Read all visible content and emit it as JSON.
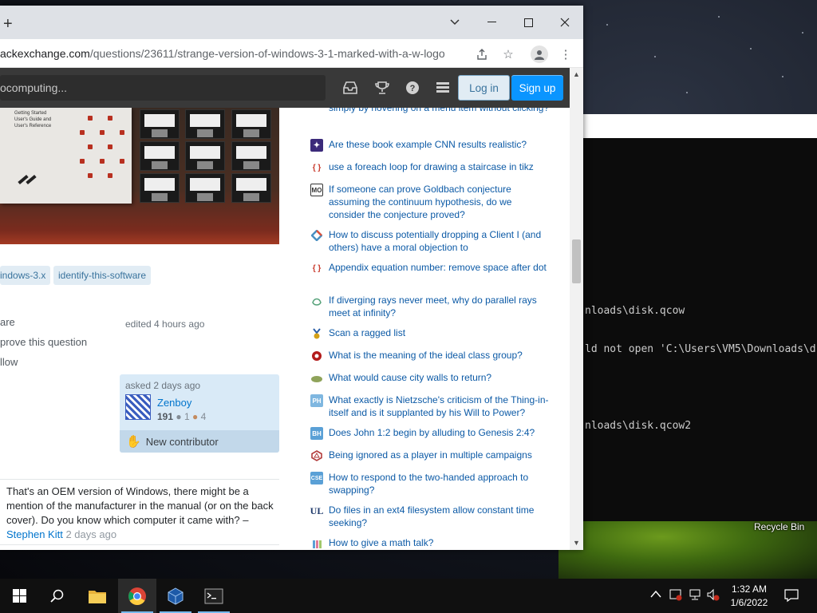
{
  "desktop": {
    "recycle_bin_label": "Recycle Bin"
  },
  "terminal": {
    "lines": [
      "nloads\\disk.qcow",
      "ld not open 'C:\\Users\\VM5\\Downloads\\d",
      "",
      "nloads\\disk.qcow2"
    ]
  },
  "browser": {
    "new_tab_icon": "plus-icon",
    "url_host": "ackexchange.com",
    "url_path": "/questions/23611/strange-version-of-windows-3-1-marked-with-a-w-logo",
    "window_controls": [
      "chevron-down-icon",
      "minimize-icon",
      "maximize-icon",
      "close-icon"
    ]
  },
  "site": {
    "search_text": "ocomputing...",
    "login_label": "Log in",
    "signup_label": "Sign up"
  },
  "question": {
    "photo_manual_title": "Getting Started\nUser's Guide and\nUser's Reference",
    "tags": [
      "indows-3.x",
      "identify-this-software"
    ],
    "actions": [
      "are",
      "prove this question",
      "llow"
    ],
    "edited_text": "edited 4 hours ago",
    "asked_text": "asked 2 days ago",
    "user_name": "Zenboy",
    "user_rep": "191",
    "silver_badges": "1",
    "bronze_badges": "4",
    "new_contributor_label": "New contributor"
  },
  "comment": {
    "text": "That's an OEM version of Windows, there might be a mention of the manufacturer in the manual (or on the back cover). Do you know which computer it came with?",
    "dash": "–",
    "author": "Stephen Kitt",
    "date": "2 days ago"
  },
  "hot_questions": [
    {
      "title": "simply by hovering on a menu item without clicking?",
      "icon": "none",
      "color": "#ffffff"
    },
    {
      "title": "Are these book example CNN results realistic?",
      "icon": "datascience-icon",
      "color": "#3b2a7a"
    },
    {
      "title": "use a foreach loop for drawing a staircase in tikz",
      "icon": "tex-icon",
      "color": "#c93b2d"
    },
    {
      "title": "If someone can prove Goldbach conjecture assuming the continuum hypothesis, do we consider the conjecture proved?",
      "icon": "mathoverflow-icon",
      "color": "#333333"
    },
    {
      "title": "How to discuss potentially dropping a Client I (and others) have a moral objection to",
      "icon": "workplace-icon",
      "color": "#4a90c2"
    },
    {
      "title": "Appendix equation number: remove space after dot",
      "icon": "tex-icon",
      "color": "#c93b2d"
    },
    {
      "title": "If diverging rays never meet, why do parallel rays meet at infinity?",
      "icon": "physics-icon",
      "color": "#56a27a"
    },
    {
      "title": "Scan a ragged list",
      "icon": "codegolf-icon",
      "color": "#d4a017"
    },
    {
      "title": "What is the meaning of the ideal class group?",
      "icon": "math-icon",
      "color": "#b21b1b"
    },
    {
      "title": "What would cause city walls to return?",
      "icon": "worldbuilding-icon",
      "color": "#8fa35a"
    },
    {
      "title": "What exactly is Nietzsche's criticism of the Thing-in-itself and is it supplanted by his Will to Power?",
      "icon": "philosophy-icon",
      "color": "#7fb7e0"
    },
    {
      "title": "Does John 1:2 begin by alluding to Genesis 2:4?",
      "icon": "hermeneutics-icon",
      "color": "#5aa0d6"
    },
    {
      "title": "Being ignored as a player in multiple campaigns",
      "icon": "rpg-icon",
      "color": "#b23b3b"
    },
    {
      "title": "How to respond to the two-handed approach to swapping?",
      "icon": "cs-icon",
      "color": "#5aa0d6"
    },
    {
      "title": "Do files in an ext4 filesystem allow constant time seeking?",
      "icon": "unix-icon",
      "color": "#1f3a6b"
    },
    {
      "title": "How to give a math talk?",
      "icon": "academia-icon",
      "color": "#5aa0d6"
    }
  ],
  "taskbar": {
    "time": "1:32 AM",
    "date": "1/6/2022",
    "items": [
      "windows-start-icon",
      "search-icon",
      "file-explorer-icon",
      "chrome-icon",
      "virtualbox-icon",
      "terminal-icon"
    ]
  }
}
